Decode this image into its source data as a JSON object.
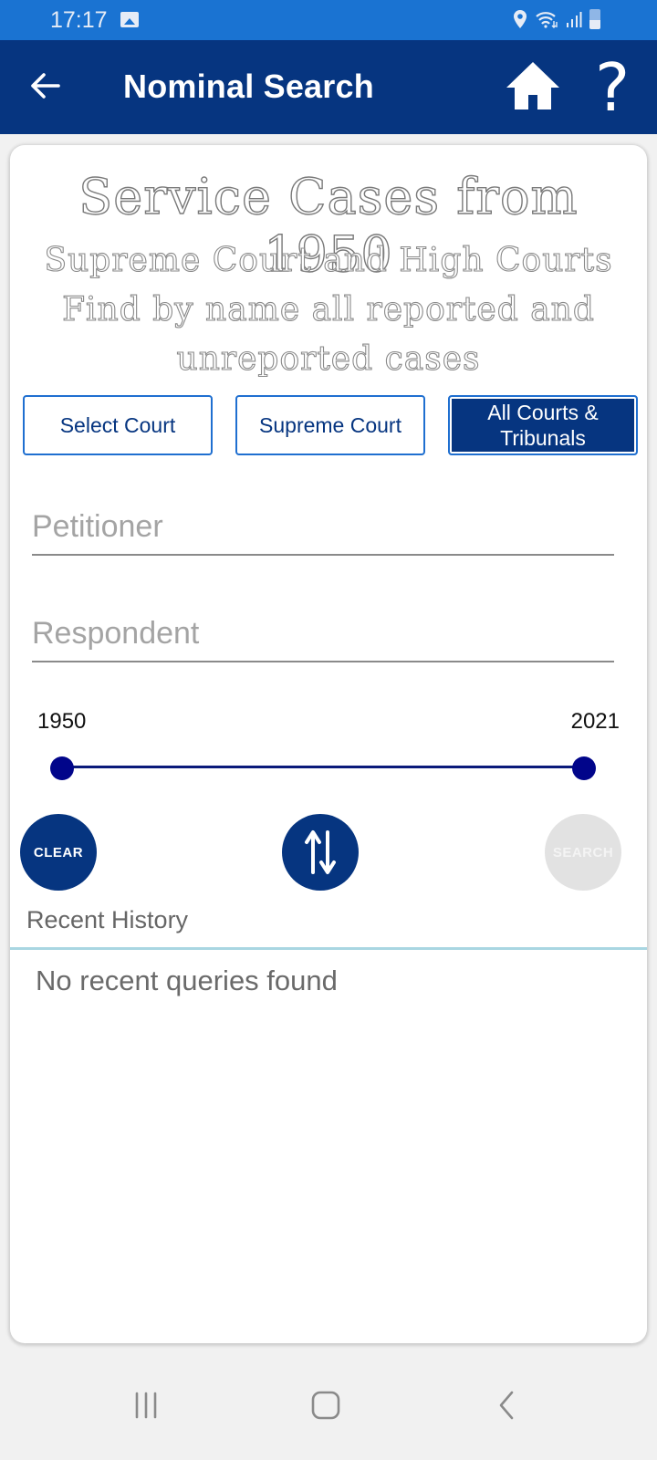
{
  "status_bar": {
    "time": "17:17",
    "icons": [
      "gallery-icon",
      "location-icon",
      "wifi-icon",
      "signal-icon",
      "battery-icon"
    ]
  },
  "app_bar": {
    "title": "Nominal Search",
    "back_icon": "arrow-left-icon",
    "home_icon": "home-icon",
    "help_label": "?"
  },
  "banner": {
    "line1": "Service Cases from 1950",
    "line2": "Supreme Court and High Courts",
    "line3": "Find by name all reported and",
    "line4": "unreported cases"
  },
  "court_filters": [
    {
      "label": "Select Court",
      "selected": false
    },
    {
      "label": "Supreme Court",
      "selected": false
    },
    {
      "label": "All Courts & Tribunals",
      "selected": true
    }
  ],
  "fields": {
    "petitioner": {
      "placeholder": "Petitioner",
      "value": ""
    },
    "respondent": {
      "placeholder": "Respondent",
      "value": ""
    }
  },
  "year_range": {
    "min_label": "1950",
    "max_label": "2021",
    "min": 1950,
    "max": 2021,
    "selected_from": 1950,
    "selected_to": 2021
  },
  "actions": {
    "clear_label": "CLEAR",
    "swap_icon": "swap-vertical-icon",
    "search_label": "SEARCH",
    "search_enabled": false
  },
  "history": {
    "label": "Recent History",
    "empty_message": "No recent queries found"
  },
  "colors": {
    "status_bar": "#1a73d2",
    "primary": "#063580",
    "accent_border": "#1f6fd0",
    "slider": "#01058a",
    "disabled": "#e2e2e2",
    "divider": "#a9d6e2"
  }
}
